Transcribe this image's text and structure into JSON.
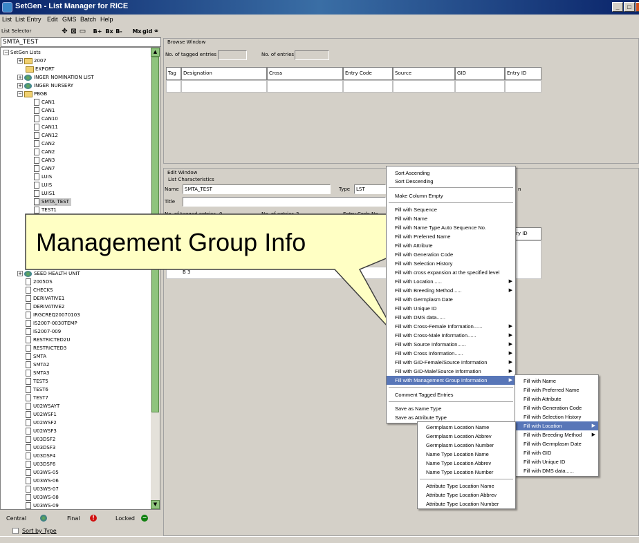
{
  "window": {
    "title": "SetGen - List Manager for RICE",
    "min": "_",
    "max": "□",
    "close": "×"
  },
  "menu": [
    "List",
    "List Entry",
    "Edit",
    "GMS",
    "Batch",
    "Help"
  ],
  "toolbar": {
    "list_selector_label": "List Selector",
    "b_plus": "B+",
    "bx": "Bx",
    "b_minus": "B-",
    "mx": "Mx",
    "gid": "gid"
  },
  "selector_value": "SMTA_TEST",
  "tree": {
    "root": "SetGen Lists",
    "items": [
      "2007",
      "EXPORT",
      "INGER NOMINATION LIST",
      "INGER NURSERY",
      "PBGB",
      "CAN1",
      "CAN1",
      "CAN10",
      "CAN11",
      "CAN12",
      "CAN2",
      "CAN2",
      "CAN3",
      "CAN7",
      "LUIS",
      "LUIS",
      "LUIS1",
      "SMTA_TEST",
      "TEST1",
      "SEED HEALTH UNIT",
      "2005DS",
      "CHECKS",
      "DERIVATIVE1",
      "DERIVATIVE2",
      "IRGCREQ20070103",
      "IS2007-0030TEMP",
      "IS2007-009",
      "RESTRICTED2U",
      "RESTRICTED3",
      "SMTA",
      "SMTA2",
      "SMTA3",
      "TEST5",
      "TEST6",
      "TEST7",
      "U02WSAYT",
      "U02WSF1",
      "U02WSF2",
      "U02WSF3",
      "U03DSF2",
      "U03DSF3",
      "U03DSF4",
      "U03DSF6",
      "U03WS-05",
      "U03WS-06",
      "U03WS-07",
      "U03WS-08",
      "U03WS-09"
    ]
  },
  "legend": {
    "central": "Central",
    "final": "Final",
    "locked": "Locked",
    "sort_by_type": "Sort by Type"
  },
  "browse": {
    "title": "Browse Window",
    "tagged_label": "No. of tagged entries",
    "entries_label": "No. of entries",
    "columns": [
      "Tag",
      "Designation",
      "Cross",
      "Entry Code",
      "Source",
      "GID",
      "Entry ID"
    ]
  },
  "edit": {
    "title": "Edit Window",
    "list_char": "List Characteristics",
    "name_label": "Name",
    "name_value": "SMTA_TEST",
    "type_label": "Type",
    "type_value": "LST",
    "title_label": "Title",
    "tagged_label": "No. of tagged entries",
    "tagged_value": "0",
    "entries_label": "No. of entries",
    "entries_value": "3",
    "entry_code_label": "Entry Code No.",
    "right_label": "n",
    "grid_col": "ry ID",
    "row_b3": "B 3"
  },
  "context_menu": {
    "items": [
      "Sort Ascending",
      "Sort Descending",
      "Make Column Empty",
      "Fill with Sequence",
      "Fill with Name",
      "Fill with Name Type Auto Sequence No.",
      "Fill with Preferred Name",
      "Fill with Attribute",
      "Fill with Generation Code",
      "Fill with Selection History",
      "Fill with cross expansion at the specified level",
      "Fill with Location......",
      "Fill with Breeding Method......",
      "Fill with Germplasm Date",
      "Fill with Unique ID",
      "Fill with DMS data......",
      "Fill with Cross-Female Information......",
      "Fill with Cross-Male Information......",
      "Fill with Source Information......",
      "Fill with Cross Information......",
      "Fill with GID-Female/Source Information",
      "Fill with GID-Male/Source Information",
      "Fill with Management Group Information",
      "Comment Tagged Entries",
      "Save as Name Type",
      "Save as Attribute Type"
    ]
  },
  "submenu1": {
    "items": [
      "Fill with Name",
      "Fill with Preferred Name",
      "Fill with Attribute",
      "Fill with Generation Code",
      "Fill with Selection History",
      "Fill with Location",
      "Fill with Breeding Method",
      "Fill with Germplasm Date",
      "Fill with GID",
      "Fill with Unique ID",
      "Fill with DMS data......"
    ]
  },
  "submenu2": {
    "items": [
      "Germplasm Location Name",
      "Germplasm Location Abbrev",
      "Germplasm Location Number",
      "Name Type Location Name",
      "Name Type Location Abbrev",
      "Name Type Location Number",
      "Attribute Type Location Name",
      "Attribute Type Location Abbrev",
      "Attribute Type Location Number"
    ]
  },
  "callout": "Management Group Info"
}
